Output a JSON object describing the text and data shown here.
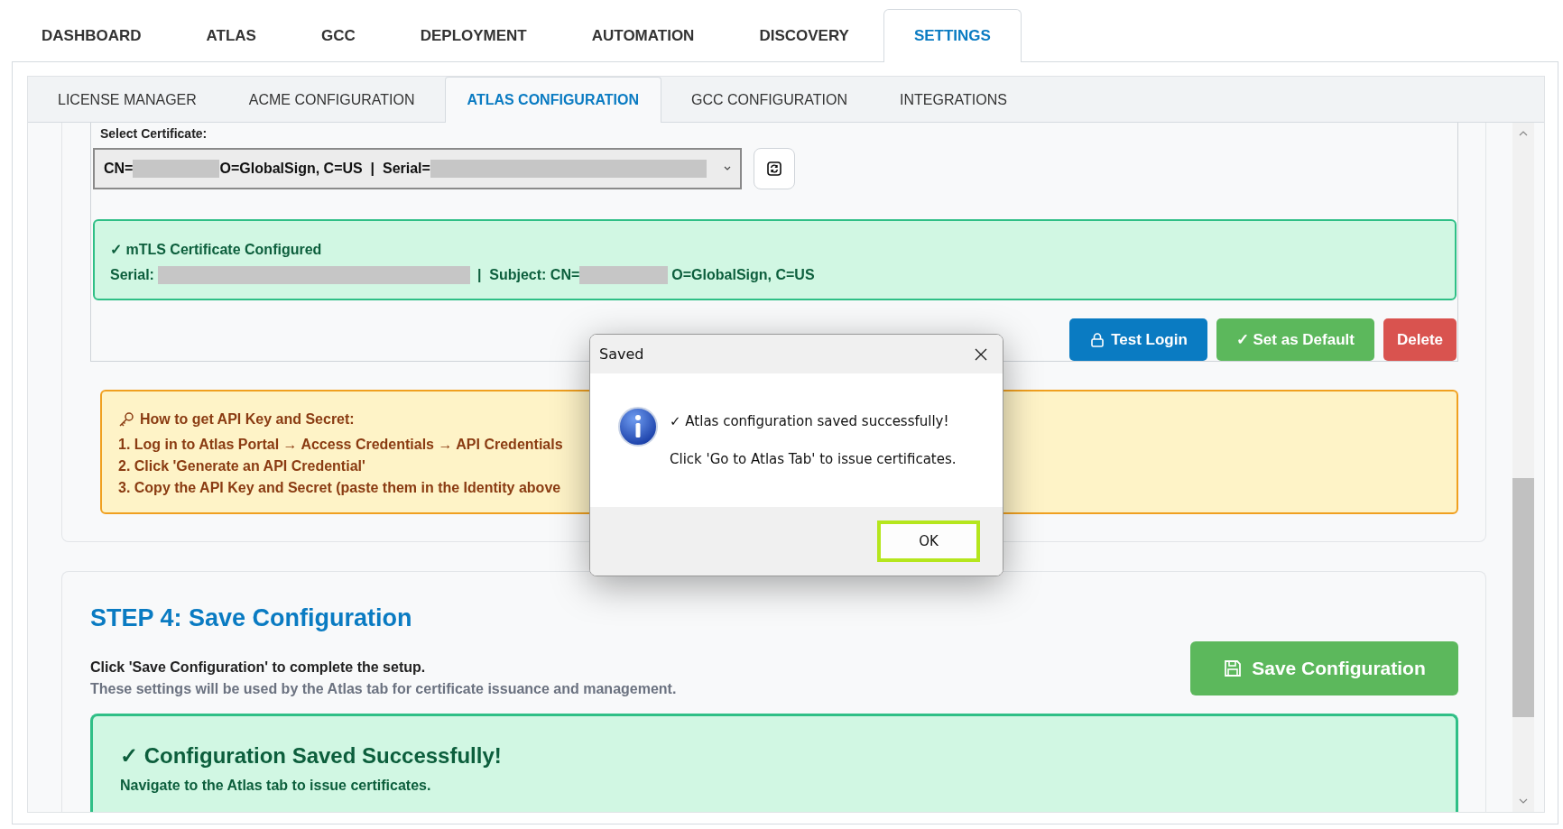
{
  "main_tabs": [
    {
      "label": "DASHBOARD",
      "selected": false
    },
    {
      "label": "ATLAS",
      "selected": false
    },
    {
      "label": "GCC",
      "selected": false
    },
    {
      "label": "DEPLOYMENT",
      "selected": false
    },
    {
      "label": "AUTOMATION",
      "selected": false
    },
    {
      "label": "DISCOVERY",
      "selected": false
    },
    {
      "label": "SETTINGS",
      "selected": true
    }
  ],
  "sub_tabs": [
    {
      "label": "LICENSE MANAGER",
      "selected": false
    },
    {
      "label": "ACME CONFIGURATION",
      "selected": false
    },
    {
      "label": "ATLAS CONFIGURATION",
      "selected": true
    },
    {
      "label": "GCC CONFIGURATION",
      "selected": false
    },
    {
      "label": "INTEGRATIONS",
      "selected": false
    }
  ],
  "certificate": {
    "label": "Select Certificate:",
    "select_segments": [
      "CN=",
      "O=GlobalSign, C=US  |  Serial="
    ],
    "status_title": "✓ mTLS Certificate Configured",
    "status_segments": [
      "Serial:",
      "|  Subject: CN=",
      "O=GlobalSign, C=US"
    ],
    "buttons": [
      {
        "label": "Test Login",
        "kind": "primary"
      },
      {
        "label": "✓ Set as Default",
        "kind": "success"
      },
      {
        "label": "Delete",
        "kind": "danger"
      }
    ]
  },
  "help": {
    "title": "How to get API Key and Secret:",
    "steps": [
      "1. Log in to Atlas Portal → Access Credentials → API Credentials",
      "2. Click 'Generate an API Credential'",
      "3. Copy the API Key and Secret (paste them in the Identity above"
    ]
  },
  "step4": {
    "title": "STEP 4: Save Configuration",
    "instruction": "Click 'Save Configuration' to complete the setup.",
    "note": "These settings will be used by the Atlas tab for certificate issuance and management.",
    "button": "Save Configuration",
    "success_title": "✓ Configuration Saved Successfully!",
    "success_text": "Navigate to the Atlas tab to issue certificates."
  },
  "dialog": {
    "title": "Saved",
    "message": "✓ Atlas configuration saved successfully!",
    "detail": "Click 'Go to Atlas Tab' to issue certificates.",
    "button": "OK"
  }
}
